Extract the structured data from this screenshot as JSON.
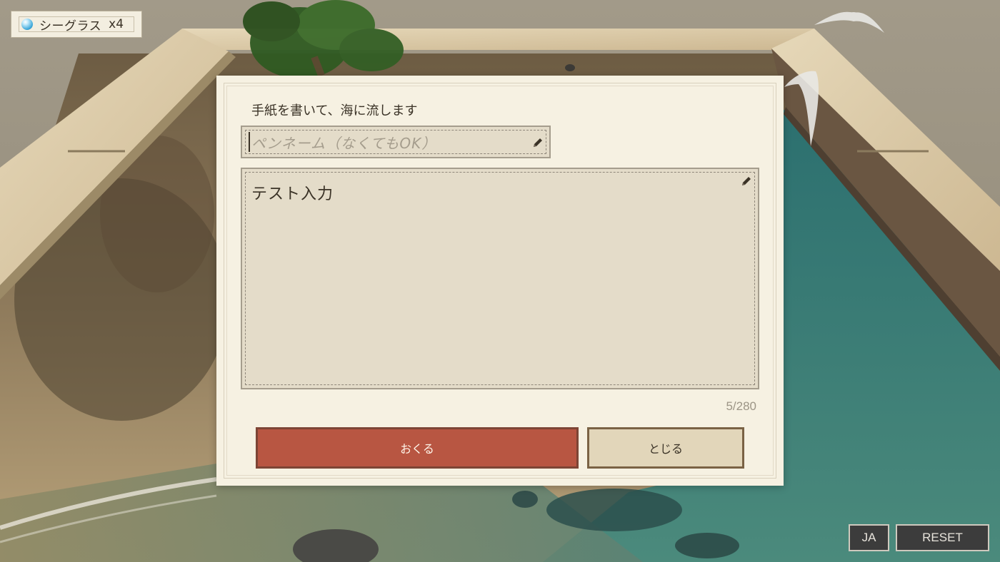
{
  "hud": {
    "seaglass_label": "シーグラス",
    "seaglass_count": "x4",
    "gem_icon": "seaglass-gem-icon",
    "lang_button": "JA",
    "reset_button": "RESET"
  },
  "dialog": {
    "title": "手紙を書いて、海に流します",
    "penname": {
      "value": "",
      "placeholder": "ペンネーム（なくてもOK）"
    },
    "message": {
      "value": "テスト入力"
    },
    "char_count": "5/280",
    "send_button": "おくる",
    "close_button": "とじる"
  },
  "colors": {
    "send_button": "#b85642",
    "close_button": "#e2d6ba",
    "dialog_paper": "#f6f1e2",
    "field_bg": "#e4dcc9",
    "water": "#3a7d78",
    "sand": "#b59e76"
  }
}
